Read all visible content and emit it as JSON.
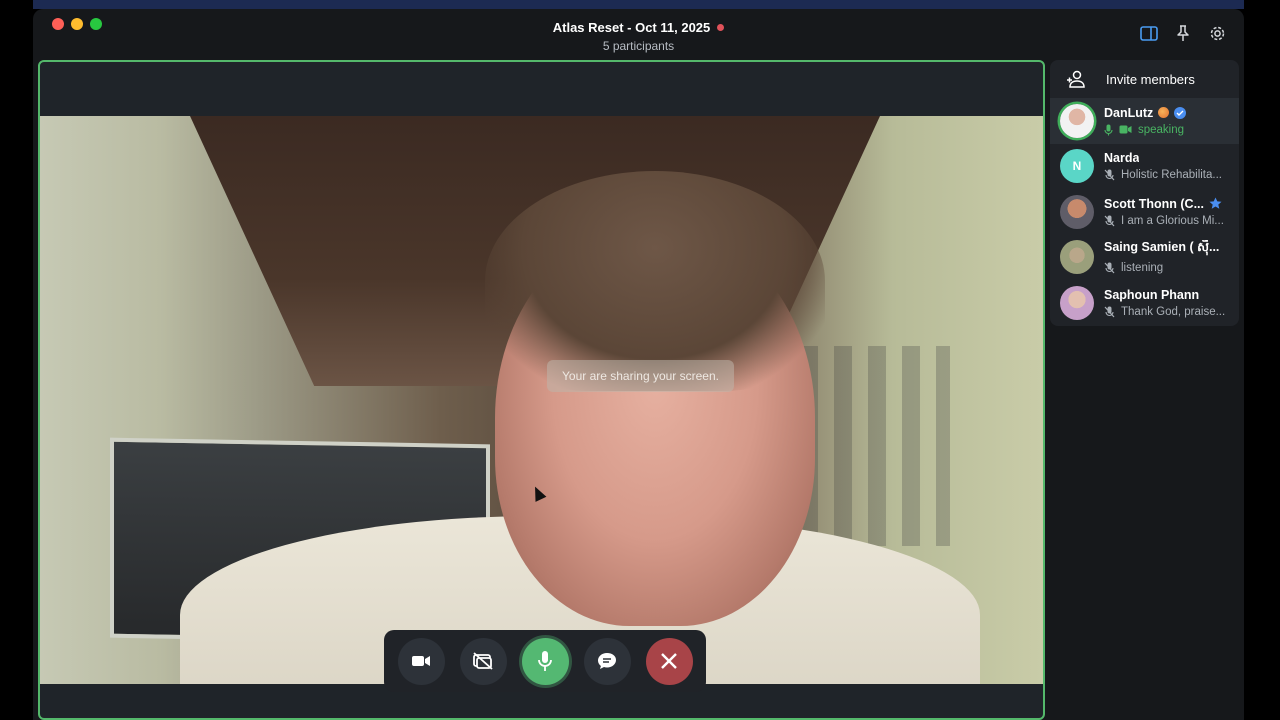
{
  "window": {
    "title": "Atlas Reset - Oct 11, 2025",
    "subtitle": "5 participants"
  },
  "stage": {
    "toast": "Your are sharing your screen."
  },
  "controls": [
    {
      "name": "camera-button",
      "icon": "video-camera-icon"
    },
    {
      "name": "screen-share-button",
      "icon": "screen-share-off-icon"
    },
    {
      "name": "microphone-button",
      "icon": "microphone-icon"
    },
    {
      "name": "chat-button",
      "icon": "chat-bubble-icon"
    },
    {
      "name": "end-call-button",
      "icon": "close-icon"
    }
  ],
  "sidebar": {
    "invite_label": "Invite members",
    "members": [
      {
        "name": "DanLutz",
        "status": "speaking",
        "initial": ""
      },
      {
        "name": "Narda",
        "status": "Holistic Rehabilita...",
        "initial": "N"
      },
      {
        "name": "Scott Thonn (C...",
        "status": "I am a Glorious Mi...",
        "initial": ""
      },
      {
        "name": "Saing Samien ( ស៊ី...",
        "status": "listening",
        "initial": ""
      },
      {
        "name": "Saphoun Phann",
        "status": "Thank God, praise...",
        "initial": ""
      }
    ]
  },
  "colors": {
    "accent_green": "#54b86b",
    "end_call_red": "#a84448",
    "verified_blue": "#4a8ef0"
  }
}
